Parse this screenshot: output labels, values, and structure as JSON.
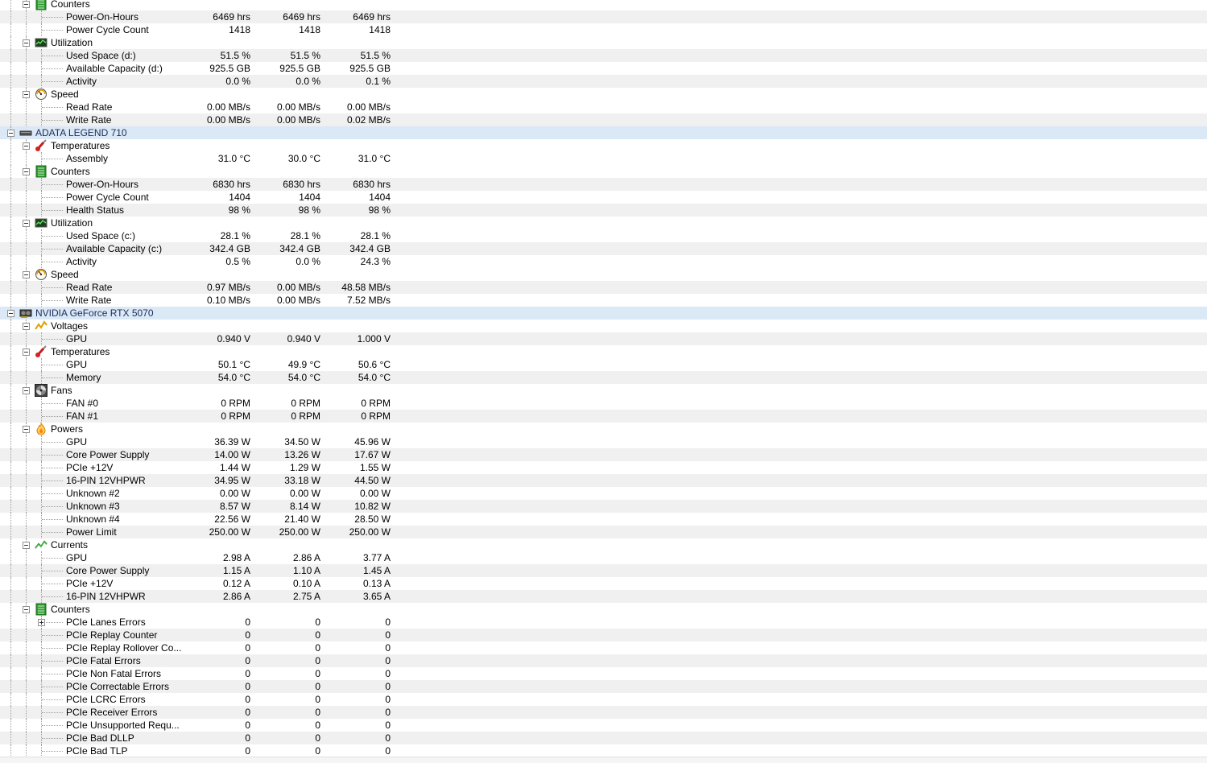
{
  "rows": [
    {
      "kind": "group",
      "label": "Counters",
      "icon": "counters-icon"
    },
    {
      "kind": "item",
      "label": "Power-On-Hours",
      "v": [
        "6469 hrs",
        "6469 hrs",
        "6469 hrs"
      ]
    },
    {
      "kind": "item",
      "label": "Power Cycle Count",
      "v": [
        "1418",
        "1418",
        "1418"
      ]
    },
    {
      "kind": "group",
      "label": "Utilization",
      "icon": "utilization-icon"
    },
    {
      "kind": "item",
      "label": "Used Space (d:)",
      "v": [
        "51.5 %",
        "51.5 %",
        "51.5 %"
      ]
    },
    {
      "kind": "item",
      "label": "Available Capacity (d:)",
      "v": [
        "925.5 GB",
        "925.5 GB",
        "925.5 GB"
      ]
    },
    {
      "kind": "item",
      "label": "Activity",
      "v": [
        "0.0 %",
        "0.0 %",
        "0.1 %"
      ]
    },
    {
      "kind": "group",
      "label": "Speed",
      "icon": "speed-gauge-icon"
    },
    {
      "kind": "item",
      "label": "Read Rate",
      "v": [
        "0.00 MB/s",
        "0.00 MB/s",
        "0.00 MB/s"
      ]
    },
    {
      "kind": "item",
      "label": "Write Rate",
      "v": [
        "0.00 MB/s",
        "0.00 MB/s",
        "0.02 MB/s"
      ]
    },
    {
      "kind": "device",
      "label": "ADATA LEGEND 710",
      "icon": "drive-icon"
    },
    {
      "kind": "group",
      "label": "Temperatures",
      "icon": "thermometer-icon"
    },
    {
      "kind": "item",
      "label": "Assembly",
      "v": [
        "31.0 °C",
        "30.0 °C",
        "31.0 °C"
      ]
    },
    {
      "kind": "group",
      "label": "Counters",
      "icon": "counters-icon"
    },
    {
      "kind": "item",
      "label": "Power-On-Hours",
      "v": [
        "6830 hrs",
        "6830 hrs",
        "6830 hrs"
      ]
    },
    {
      "kind": "item",
      "label": "Power Cycle Count",
      "v": [
        "1404",
        "1404",
        "1404"
      ]
    },
    {
      "kind": "item",
      "label": "Health Status",
      "v": [
        "98 %",
        "98 %",
        "98 %"
      ]
    },
    {
      "kind": "group",
      "label": "Utilization",
      "icon": "utilization-icon"
    },
    {
      "kind": "item",
      "label": "Used Space (c:)",
      "v": [
        "28.1 %",
        "28.1 %",
        "28.1 %"
      ]
    },
    {
      "kind": "item",
      "label": "Available Capacity (c:)",
      "v": [
        "342.4 GB",
        "342.4 GB",
        "342.4 GB"
      ]
    },
    {
      "kind": "item",
      "label": "Activity",
      "v": [
        "0.5 %",
        "0.0 %",
        "24.3 %"
      ]
    },
    {
      "kind": "group",
      "label": "Speed",
      "icon": "speed-gauge-icon"
    },
    {
      "kind": "item",
      "label": "Read Rate",
      "v": [
        "0.97 MB/s",
        "0.00 MB/s",
        "48.58 MB/s"
      ]
    },
    {
      "kind": "item",
      "label": "Write Rate",
      "v": [
        "0.10 MB/s",
        "0.00 MB/s",
        "7.52 MB/s"
      ]
    },
    {
      "kind": "device",
      "label": "NVIDIA GeForce RTX 5070",
      "icon": "gpu-card-icon"
    },
    {
      "kind": "group",
      "label": "Voltages",
      "icon": "voltage-icon"
    },
    {
      "kind": "item",
      "label": "GPU",
      "v": [
        "0.940 V",
        "0.940 V",
        "1.000 V"
      ]
    },
    {
      "kind": "group",
      "label": "Temperatures",
      "icon": "thermometer-icon"
    },
    {
      "kind": "item",
      "label": "GPU",
      "v": [
        "50.1 °C",
        "49.9 °C",
        "50.6 °C"
      ]
    },
    {
      "kind": "item",
      "label": "Memory",
      "v": [
        "54.0 °C",
        "54.0 °C",
        "54.0 °C"
      ]
    },
    {
      "kind": "group",
      "label": "Fans",
      "icon": "fan-icon"
    },
    {
      "kind": "item",
      "label": "FAN #0",
      "v": [
        "0 RPM",
        "0 RPM",
        "0 RPM"
      ]
    },
    {
      "kind": "item",
      "label": "FAN #1",
      "v": [
        "0 RPM",
        "0 RPM",
        "0 RPM"
      ]
    },
    {
      "kind": "group",
      "label": "Powers",
      "icon": "power-flame-icon"
    },
    {
      "kind": "item",
      "label": "GPU",
      "v": [
        "36.39 W",
        "34.50 W",
        "45.96 W"
      ]
    },
    {
      "kind": "item",
      "label": "Core Power Supply",
      "v": [
        "14.00 W",
        "13.26 W",
        "17.67 W"
      ]
    },
    {
      "kind": "item",
      "label": "PCIe +12V",
      "v": [
        "1.44 W",
        "1.29 W",
        "1.55 W"
      ]
    },
    {
      "kind": "item",
      "label": "16-PIN 12VHPWR",
      "v": [
        "34.95 W",
        "33.18 W",
        "44.50 W"
      ]
    },
    {
      "kind": "item",
      "label": "Unknown #2",
      "v": [
        "0.00 W",
        "0.00 W",
        "0.00 W"
      ]
    },
    {
      "kind": "item",
      "label": "Unknown #3",
      "v": [
        "8.57 W",
        "8.14 W",
        "10.82 W"
      ]
    },
    {
      "kind": "item",
      "label": "Unknown #4",
      "v": [
        "22.56 W",
        "21.40 W",
        "28.50 W"
      ]
    },
    {
      "kind": "item",
      "label": "Power Limit",
      "v": [
        "250.00 W",
        "250.00 W",
        "250.00 W"
      ]
    },
    {
      "kind": "group",
      "label": "Currents",
      "icon": "current-icon"
    },
    {
      "kind": "item",
      "label": "GPU",
      "v": [
        "2.98 A",
        "2.86 A",
        "3.77 A"
      ]
    },
    {
      "kind": "item",
      "label": "Core Power Supply",
      "v": [
        "1.15 A",
        "1.10 A",
        "1.45 A"
      ]
    },
    {
      "kind": "item",
      "label": "PCIe +12V",
      "v": [
        "0.12 A",
        "0.10 A",
        "0.13 A"
      ]
    },
    {
      "kind": "item",
      "label": "16-PIN 12VHPWR",
      "v": [
        "2.86 A",
        "2.75 A",
        "3.65 A"
      ]
    },
    {
      "kind": "group",
      "label": "Counters",
      "icon": "counters-icon"
    },
    {
      "kind": "item",
      "label": "PCIe Lanes Errors",
      "v": [
        "0",
        "0",
        "0"
      ],
      "expandable": true
    },
    {
      "kind": "item",
      "label": "PCIe Replay Counter",
      "v": [
        "0",
        "0",
        "0"
      ]
    },
    {
      "kind": "item",
      "label": "PCIe Replay Rollover Co...",
      "v": [
        "0",
        "0",
        "0"
      ]
    },
    {
      "kind": "item",
      "label": "PCIe Fatal Errors",
      "v": [
        "0",
        "0",
        "0"
      ]
    },
    {
      "kind": "item",
      "label": "PCIe Non Fatal Errors",
      "v": [
        "0",
        "0",
        "0"
      ]
    },
    {
      "kind": "item",
      "label": "PCIe Correctable Errors",
      "v": [
        "0",
        "0",
        "0"
      ]
    },
    {
      "kind": "item",
      "label": "PCIe LCRC Errors",
      "v": [
        "0",
        "0",
        "0"
      ]
    },
    {
      "kind": "item",
      "label": "PCIe Receiver Errors",
      "v": [
        "0",
        "0",
        "0"
      ]
    },
    {
      "kind": "item",
      "label": "PCIe Unsupported Requ...",
      "v": [
        "0",
        "0",
        "0"
      ]
    },
    {
      "kind": "item",
      "label": "PCIe Bad DLLP",
      "v": [
        "0",
        "0",
        "0"
      ]
    },
    {
      "kind": "item",
      "label": "PCIe Bad TLP",
      "v": [
        "0",
        "0",
        "0"
      ]
    }
  ]
}
